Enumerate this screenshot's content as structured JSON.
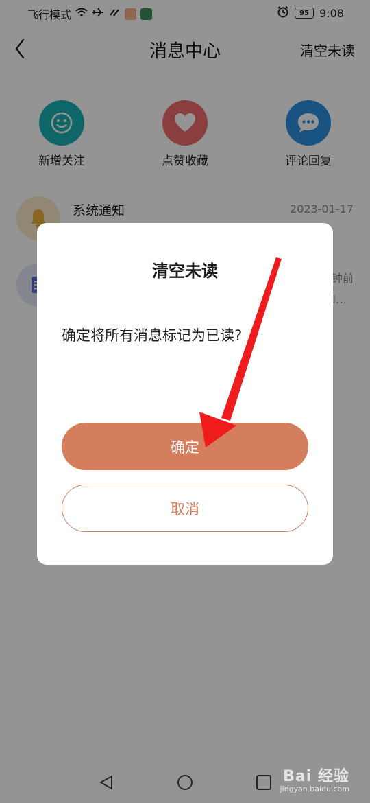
{
  "status_bar": {
    "left_text": "飞行模式",
    "battery": "95",
    "time": "9:08"
  },
  "nav": {
    "title": "消息中心",
    "clear_unread": "清空未读"
  },
  "categories": [
    {
      "label": "新增关注",
      "color": "#1bb0b3",
      "icon": "smiley-icon"
    },
    {
      "label": "点赞收藏",
      "color": "#f06b6b",
      "icon": "heart-icon"
    },
    {
      "label": "评论回复",
      "color": "#2b8fe0",
      "icon": "chat-bubble-icon"
    }
  ],
  "messages": [
    {
      "title": "系统通知",
      "time": "2023-01-17",
      "icon": "bell-icon",
      "avatar_color": "#fbe9c9"
    },
    {
      "title": "",
      "time": "钟前",
      "subtitle": "l…",
      "icon": "document-icon",
      "avatar_color": "#e3e8f8"
    }
  ],
  "dialog": {
    "title": "清空未读",
    "message": "确定将所有消息标记为已读?",
    "confirm_label": "确定",
    "cancel_label": "取消",
    "accent_color": "#d57e5e"
  },
  "watermark": {
    "main": "Bai 经验",
    "sub": "jingyan.baidu.com"
  }
}
